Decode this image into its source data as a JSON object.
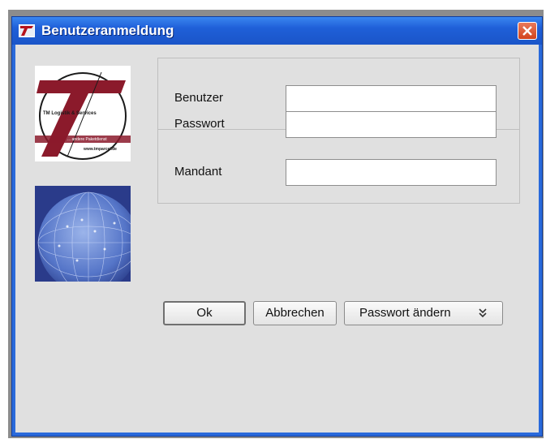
{
  "window": {
    "title": "Benutzeranmeldung"
  },
  "logo": {
    "company_line": "TM Logistik & Services",
    "tagline": "... andere Paketdienst",
    "url": "www.tmparcel.de"
  },
  "form": {
    "user_label": "Benutzer",
    "user_value": "",
    "password_label": "Passwort",
    "password_value": "",
    "client_label": "Mandant",
    "client_value": ""
  },
  "buttons": {
    "ok": "Ok",
    "cancel": "Abbrechen",
    "change_password": "Passwort ändern",
    "change_password_icon": "double-chevron-down"
  },
  "colors": {
    "titlebar": "#1f5fd8",
    "client_bg": "#e0e0e0",
    "logo_red": "#8b1a2b",
    "close_button": "#d2431c"
  }
}
